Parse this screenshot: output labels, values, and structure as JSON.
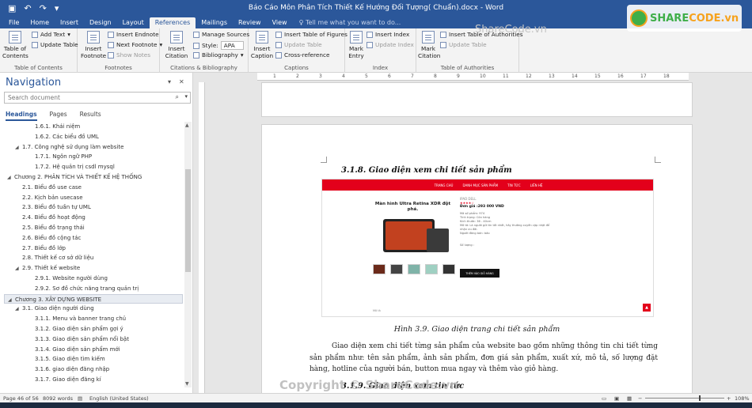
{
  "window": {
    "title": "Báo Cáo Môn Phân Tích Thiết Kế Hướng Đối Tượng( Chuẩn).docx - Word",
    "qa_icons": [
      "save-icon",
      "undo-icon",
      "redo-icon",
      "touch-icon"
    ]
  },
  "tabs": [
    "File",
    "Home",
    "Insert",
    "Design",
    "Layout",
    "References",
    "Mailings",
    "Review",
    "View"
  ],
  "active_tab": "References",
  "tell_me": "Tell me what you want to do...",
  "ribbon": {
    "toc": {
      "big_label": "Table of Contents",
      "add_text": "Add Text",
      "update_table": "Update Table",
      "group": "Table of Contents"
    },
    "footnotes": {
      "insert_footnote": "Insert Footnote",
      "insert_endnote": "Insert Endnote",
      "next_footnote": "Next Footnote",
      "show_notes": "Show Notes",
      "group": "Footnotes"
    },
    "citations": {
      "insert_citation": "Insert Citation",
      "manage_sources": "Manage Sources",
      "style_label": "Style:",
      "style_value": "APA",
      "bibliography": "Bibliography",
      "group": "Citations & Bibliography"
    },
    "captions": {
      "insert_caption": "Insert Caption",
      "insert_tof": "Insert Table of Figures",
      "update_table": "Update Table",
      "cross_reference": "Cross-reference",
      "group": "Captions"
    },
    "index": {
      "mark_entry": "Mark Entry",
      "insert_index": "Insert Index",
      "update_index": "Update Index",
      "group": "Index"
    },
    "toa": {
      "mark_citation": "Mark Citation",
      "insert_toa": "Insert Table of Authorities",
      "update_table": "Update Table",
      "group": "Table of Authorities"
    }
  },
  "navigation": {
    "title": "Navigation",
    "search_placeholder": "Search document",
    "tabs": [
      "Headings",
      "Pages",
      "Results"
    ],
    "items": [
      {
        "text": "1.6.1. Khái niệm",
        "level": 3,
        "tri": ""
      },
      {
        "text": "1.6.2. Các biểu đồ UML",
        "level": 3,
        "tri": ""
      },
      {
        "text": "1.7. Công nghệ sử dụng làm website",
        "level": 2,
        "tri": "◢"
      },
      {
        "text": "1.7.1. Ngôn ngữ PHP",
        "level": 3,
        "tri": ""
      },
      {
        "text": "1.7.2. Hệ quản trị csdl mysql",
        "level": 3,
        "tri": ""
      },
      {
        "text": "Chương 2. PHÂN TÍCH VÀ THIẾT KẾ HỆ THỐNG",
        "level": 1,
        "tri": "◢"
      },
      {
        "text": "2.1. Biểu đồ use case",
        "level": 2,
        "tri": ""
      },
      {
        "text": "2.2. Kịch bản usecase",
        "level": 2,
        "tri": ""
      },
      {
        "text": "2.3. Biểu đồ tuần tự UML",
        "level": 2,
        "tri": ""
      },
      {
        "text": "2.4. Biểu đồ hoạt động",
        "level": 2,
        "tri": ""
      },
      {
        "text": "2.5. Biểu đồ trạng thái",
        "level": 2,
        "tri": ""
      },
      {
        "text": "2.6. Biểu đồ cộng tác",
        "level": 2,
        "tri": ""
      },
      {
        "text": "2.7. Biểu đồ lớp",
        "level": 2,
        "tri": ""
      },
      {
        "text": "2.8. Thiết kế cơ sở dữ liệu",
        "level": 2,
        "tri": ""
      },
      {
        "text": "2.9. Thiết kế website",
        "level": 2,
        "tri": "◢"
      },
      {
        "text": "2.9.1. Website người dùng",
        "level": 3,
        "tri": ""
      },
      {
        "text": "2.9.2. Sơ đồ chức năng trang quản trị",
        "level": 3,
        "tri": ""
      },
      {
        "text": "Chương 3. XÂY DỰNG WEBSITE",
        "level": 1,
        "tri": "◢",
        "selected": true
      },
      {
        "text": "3.1. Giao diện người dùng",
        "level": 2,
        "tri": "◢"
      },
      {
        "text": "3.1.1. Menu và banner trang chủ",
        "level": 3,
        "tri": ""
      },
      {
        "text": "3.1.2. Giao diện sản phẩm gợi ý",
        "level": 3,
        "tri": ""
      },
      {
        "text": "3.1.3. Giao diện sản phẩm nổi bật",
        "level": 3,
        "tri": ""
      },
      {
        "text": "3.1.4. Giao diện sản phẩm mới",
        "level": 3,
        "tri": ""
      },
      {
        "text": "3.1.5. Giao diện tìm kiếm",
        "level": 3,
        "tri": ""
      },
      {
        "text": "3.1.6. giao diện đăng nhập",
        "level": 3,
        "tri": ""
      },
      {
        "text": "3.1.7. Giao diện đăng kí",
        "level": 3,
        "tri": ""
      }
    ]
  },
  "ruler": {
    "marks": [
      "1",
      "2",
      "3",
      "4",
      "5",
      "6",
      "7",
      "8",
      "9",
      "10",
      "11",
      "12",
      "13",
      "14",
      "15",
      "16",
      "17",
      "18"
    ]
  },
  "document": {
    "heading": "3.1.8. Giao diện xem chi tiết sản phẩm",
    "embedded": {
      "menu": [
        "TRANG CHỦ",
        "DANH MỤC SẢN PHẨM",
        "TIN TỨC",
        "LIÊN HỆ"
      ],
      "product_title": "Màn hình Ultra Retina XDR đột phá.",
      "brand": "IPAD DELL",
      "stars": "★★★★☆",
      "price": "Đơn giá :293 000 VND",
      "lines": [
        "Mã số phẩm: 974",
        "Tình trạng: Còn hàng",
        "Kích thước: 36 - 40cm",
        "Mô tả: Là người gửi tin tốt nhất, hãy thường xuyên cập nhật để nhận ưu đãi.",
        "Người đăng bán: bảo"
      ],
      "qty_label": "Số lượng :",
      "buy_label": "THÊM VÀO GIỎ HÀNG",
      "up_arrow": "▲",
      "foot": "Mô tả"
    },
    "caption": "Hình 3.9. Giao diện trang chi tiết sản phẩm",
    "paragraph": "Giao diện xem chi tiết từng sản phẩm của website bao gồm những thông tin chi tiết từng sản phẩm như: tên sản phẩm, ảnh sản phẩm, đơn giá sản phẩm, xuất xứ, mô tả, số lượng đặt hàng, hotline của người bán, button mua ngay và thêm vào giỏ hàng.",
    "heading2": "3.1.9. Giao diện xem tin tức"
  },
  "status": {
    "page": "Page 46 of 56",
    "words": "8092 words",
    "language": "English (United States)",
    "zoom": "108%",
    "zoom_value": 0.68
  },
  "watermarks": {
    "bottom": "Copyright © ShareCode.vn",
    "top": "ShareCode.vn",
    "logo_a": "SHARE",
    "logo_b": "CODE.vn"
  },
  "colors": {
    "word_blue": "#2b579a",
    "brand_red": "#e3001b",
    "logo_green": "#3fae49",
    "logo_orange": "#f6a21d"
  }
}
